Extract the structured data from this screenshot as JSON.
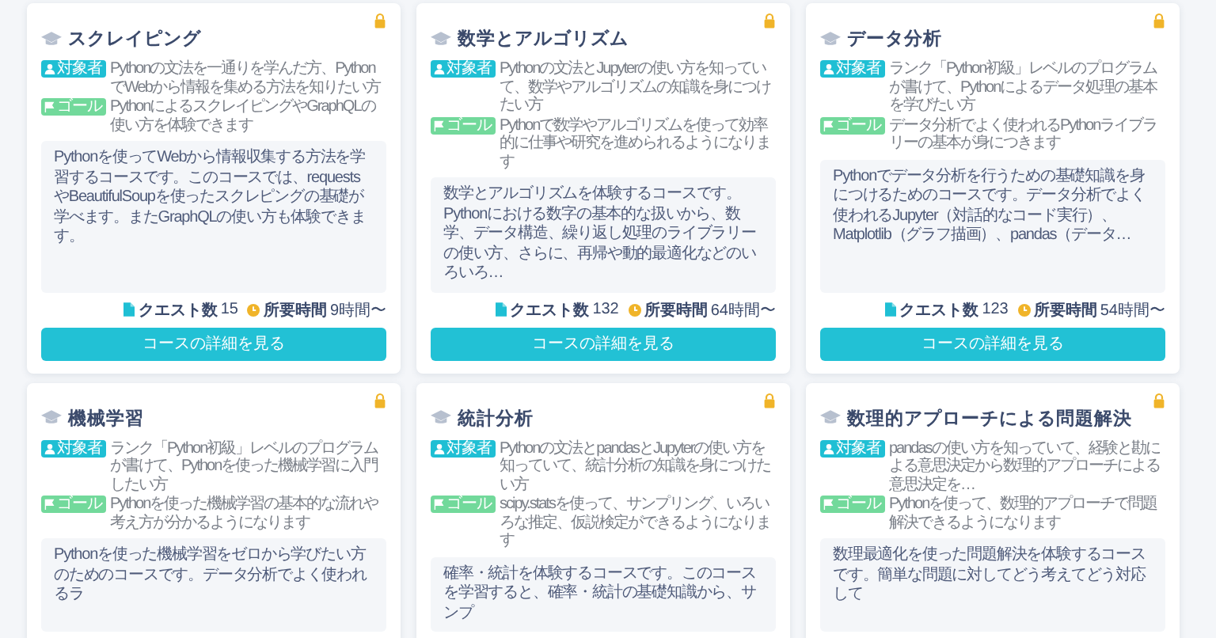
{
  "courses": [
    {
      "title": "スクレイピング",
      "locked": true,
      "target": {
        "badge": "対象者",
        "text": "Pythonの文法を一通りを学んだ方、PythonでWebから情報を集める方法を知りたい方"
      },
      "goal": {
        "badge": "ゴール",
        "text": "PythonによるスクレイピングやGraphQLの使い方を体験できます"
      },
      "description": "Pythonを使ってWebから情報収集する方法を学習するコースです。このコースでは、requestsやBeautifulSoupを使ったスクレピングの基礎が学べます。またGraphQLの使い方も体験できます。",
      "stats": [
        {
          "kind": "quests",
          "label": "クエスト数",
          "value": "15"
        },
        {
          "kind": "duration",
          "label": "所要時間",
          "value": "9時間〜"
        }
      ],
      "button": "コースの詳細を見る"
    },
    {
      "title": "数学とアルゴリズム",
      "locked": true,
      "target": {
        "badge": "対象者",
        "text": "Pythonの文法とJupyterの使い方を知っていて、数学やアルゴリズムの知識を身につけたい方"
      },
      "goal": {
        "badge": "ゴール",
        "text": "Pythonで数学やアルゴリズムを使って効率的に仕事や研究を進められるようになります"
      },
      "description": "数学とアルゴリズムを体験するコースです。Pythonにおける数字の基本的な扱いから、数学、データ構造、繰り返し処理のライブラリーの使い方、さらに、再帰や動的最適化などのいろいろ…",
      "stats": [
        {
          "kind": "quests",
          "label": "クエスト数",
          "value": "132"
        },
        {
          "kind": "duration",
          "label": "所要時間",
          "value": "64時間〜"
        }
      ],
      "button": "コースの詳細を見る"
    },
    {
      "title": "データ分析",
      "locked": true,
      "target": {
        "badge": "対象者",
        "text": "ランク「Python初級」レベルのプログラムが書けて、Pythonによるデータ処理の基本を学びたい方"
      },
      "goal": {
        "badge": "ゴール",
        "text": "データ分析でよく使われるPythonライブラリーの基本が身につきます"
      },
      "description": "Pythonでデータ分析を行うための基礎知識を身につけるためのコースです。データ分析でよく使われるJupyter（対話的なコード実行）、Matplotlib（グラフ描画）、pandas（データ…",
      "stats": [
        {
          "kind": "quests",
          "label": "クエスト数",
          "value": "123"
        },
        {
          "kind": "duration",
          "label": "所要時間",
          "value": "54時間〜"
        }
      ],
      "button": "コースの詳細を見る"
    },
    {
      "title": "機械学習",
      "locked": true,
      "target": {
        "badge": "対象者",
        "text": "ランク「Python初級」レベルのプログラムが書けて、Pythonを使った機械学習に入門したい方"
      },
      "goal": {
        "badge": "ゴール",
        "text": "Pythonを使った機械学習の基本的な流れや考え方が分かるようになります"
      },
      "description": "Pythonを使った機械学習をゼロから学びたい方のためのコースです。データ分析でよく使われるラ"
    },
    {
      "title": "統計分析",
      "locked": true,
      "target": {
        "badge": "対象者",
        "text": "Pythonの文法とpandasとJupyterの使い方を知っていて、統計分析の知識を身につけたい方"
      },
      "goal": {
        "badge": "ゴール",
        "text": "scipy.statsを使って、サンプリング、いろいろな推定、仮説検定ができるようになります"
      },
      "description": "確率・統計を体験するコースです。このコースを学習すると、確率・統計の基礎知識から、サンプ"
    },
    {
      "title": "数理的アプローチによる問題解決",
      "locked": true,
      "target": {
        "badge": "対象者",
        "text": "pandasの使い方を知っていて、経験と勘による意思決定から数理的アプローチによる意思決定を…"
      },
      "goal": {
        "badge": "ゴール",
        "text": "Pythonを使って、数理的アプローチで問題解決できるようになります"
      },
      "description": "数理最適化を使った問題解決を体験するコースです。簡単な問題に対してどう考えてどう対応して"
    }
  ]
}
